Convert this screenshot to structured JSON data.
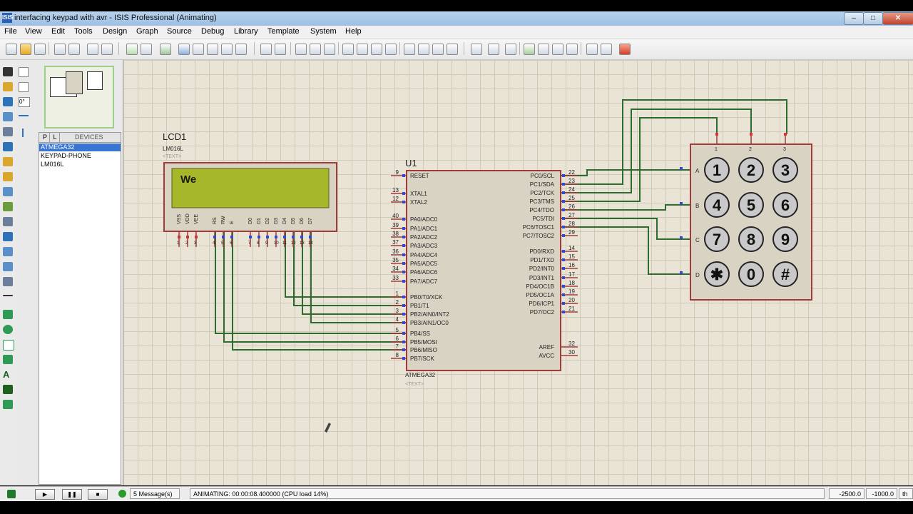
{
  "window": {
    "title": "interfacing keypad with avr - ISIS Professional (Animating)",
    "app_icon": "isis-app-icon"
  },
  "menu": [
    "File",
    "View",
    "Edit",
    "Tools",
    "Design",
    "Graph",
    "Source",
    "Debug",
    "Library",
    "Template",
    "System",
    "Help"
  ],
  "left_toolbar": {
    "rotation_value": "0°"
  },
  "device_panel": {
    "tab_p": "P",
    "tab_l": "L",
    "header": "DEVICES",
    "items": [
      {
        "label": "ATMEGA32",
        "selected": true
      },
      {
        "label": "KEYPAD-PHONE",
        "selected": false
      },
      {
        "label": "LM016L",
        "selected": false
      }
    ]
  },
  "schematic": {
    "lcd": {
      "ref": "LCD1",
      "part": "LM016L",
      "text_placeholder": "<TEXT>",
      "display_text": "We",
      "pin_labels_a": [
        "VSS",
        "VDD",
        "VEE"
      ],
      "pin_labels_b": [
        "RS",
        "RW",
        "E"
      ],
      "pin_labels_c": [
        "D0",
        "D1",
        "D2",
        "D3",
        "D4",
        "D5",
        "D6",
        "D7"
      ],
      "pin_numbers": [
        "1",
        "2",
        "3",
        "4",
        "5",
        "6",
        "7",
        "8",
        "9",
        "10",
        "11",
        "12",
        "13",
        "14"
      ]
    },
    "mcu": {
      "ref": "U1",
      "part": "ATMEGA32",
      "text_placeholder": "<TEXT>",
      "left_pins": [
        {
          "num": "9",
          "name": "RESET"
        },
        {
          "num": "13",
          "name": "XTAL1"
        },
        {
          "num": "12",
          "name": "XTAL2"
        },
        {
          "num": "40",
          "name": "PA0/ADC0"
        },
        {
          "num": "39",
          "name": "PA1/ADC1"
        },
        {
          "num": "38",
          "name": "PA2/ADC2"
        },
        {
          "num": "37",
          "name": "PA3/ADC3"
        },
        {
          "num": "36",
          "name": "PA4/ADC4"
        },
        {
          "num": "35",
          "name": "PA5/ADC5"
        },
        {
          "num": "34",
          "name": "PA6/ADC6"
        },
        {
          "num": "33",
          "name": "PA7/ADC7"
        },
        {
          "num": "1",
          "name": "PB0/T0/XCK"
        },
        {
          "num": "2",
          "name": "PB1/T1"
        },
        {
          "num": "3",
          "name": "PB2/AIN0/INT2"
        },
        {
          "num": "4",
          "name": "PB3/AIN1/OC0"
        },
        {
          "num": "5",
          "name": "PB4/SS"
        },
        {
          "num": "6",
          "name": "PB5/MOSI"
        },
        {
          "num": "7",
          "name": "PB6/MISO"
        },
        {
          "num": "8",
          "name": "PB7/SCK"
        }
      ],
      "right_pins": [
        {
          "num": "22",
          "name": "PC0/SCL"
        },
        {
          "num": "23",
          "name": "PC1/SDA"
        },
        {
          "num": "24",
          "name": "PC2/TCK"
        },
        {
          "num": "25",
          "name": "PC3/TMS"
        },
        {
          "num": "26",
          "name": "PC4/TDO"
        },
        {
          "num": "27",
          "name": "PC5/TDI"
        },
        {
          "num": "28",
          "name": "PC6/TOSC1"
        },
        {
          "num": "29",
          "name": "PC7/TOSC2"
        },
        {
          "num": "14",
          "name": "PD0/RXD"
        },
        {
          "num": "15",
          "name": "PD1/TXD"
        },
        {
          "num": "16",
          "name": "PD2/INT0"
        },
        {
          "num": "17",
          "name": "PD3/INT1"
        },
        {
          "num": "18",
          "name": "PD4/OC1B"
        },
        {
          "num": "19",
          "name": "PD5/OC1A"
        },
        {
          "num": "20",
          "name": "PD6/ICP1"
        },
        {
          "num": "21",
          "name": "PD7/OC2"
        },
        {
          "num": "32",
          "name": "AREF"
        },
        {
          "num": "30",
          "name": "AVCC"
        }
      ]
    },
    "keypad": {
      "rows": [
        "A",
        "B",
        "C",
        "D"
      ],
      "cols": [
        "1",
        "2",
        "3"
      ],
      "keys": [
        [
          "1",
          "2",
          "3"
        ],
        [
          "4",
          "5",
          "6"
        ],
        [
          "7",
          "8",
          "9"
        ],
        [
          "✱",
          "0",
          "#"
        ]
      ]
    }
  },
  "statusbar": {
    "messages": "5 Message(s)",
    "animating": "ANIMATING: 00:00:08.400000 (CPU load 14%)",
    "coord_x": "-2500.0",
    "coord_y": "-1000.0",
    "unit": "th"
  },
  "colors": {
    "wire": "#2e6b2e",
    "component_border": "#a33a3a",
    "component_fill": "#d9d3c3",
    "lcd_screen": "#a6b82a",
    "grid_background": "#e9e4d6"
  }
}
